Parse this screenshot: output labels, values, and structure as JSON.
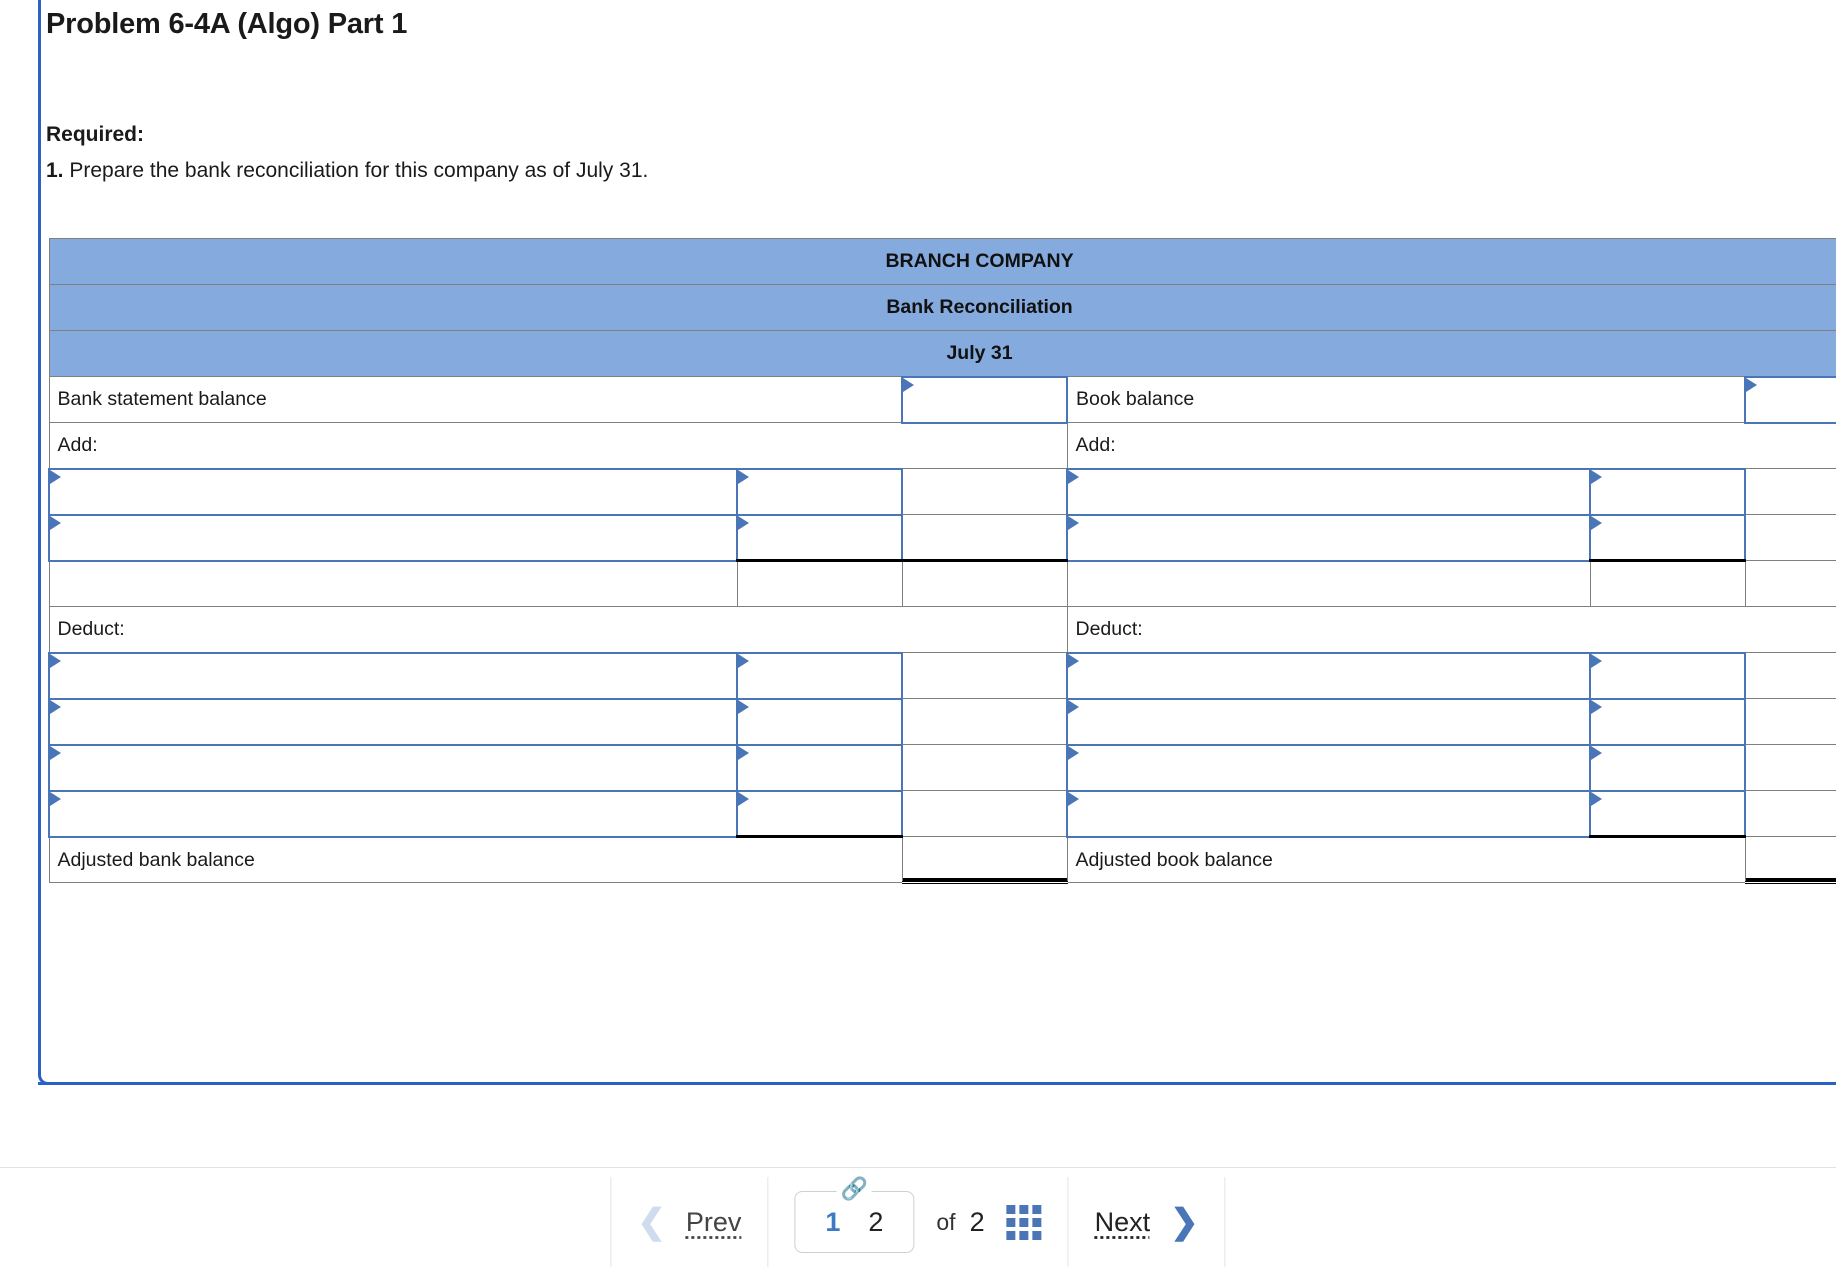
{
  "question": {
    "title": "Problem 6-4A (Algo) Part 1",
    "required_label": "Required:",
    "requirement_number": "1.",
    "requirement_text": "Prepare the bank reconciliation for this company as of July 31."
  },
  "worksheet": {
    "header": {
      "company": "BRANCH COMPANY",
      "statement": "Bank Reconciliation",
      "date": "July 31"
    },
    "left": {
      "opening_label": "Bank statement balance",
      "add_label": "Add:",
      "deduct_label": "Deduct:",
      "closing_label": "Adjusted bank balance",
      "opening_amount": "",
      "closing_amount": "",
      "add_rows": [
        {
          "description": "",
          "amount": ""
        },
        {
          "description": "",
          "amount": ""
        }
      ],
      "add_subtotal": "",
      "deduct_rows": [
        {
          "description": "",
          "amount": ""
        },
        {
          "description": "",
          "amount": ""
        },
        {
          "description": "",
          "amount": ""
        },
        {
          "description": "",
          "amount": ""
        }
      ]
    },
    "right": {
      "opening_label": "Book balance",
      "add_label": "Add:",
      "deduct_label": "Deduct:",
      "closing_label": "Adjusted book balance",
      "opening_amount": "",
      "closing_amount": "",
      "add_rows": [
        {
          "description": "",
          "amount": ""
        },
        {
          "description": "",
          "amount": ""
        }
      ],
      "add_subtotal": "",
      "deduct_rows": [
        {
          "description": "",
          "amount": ""
        },
        {
          "description": "",
          "amount": ""
        },
        {
          "description": "",
          "amount": ""
        },
        {
          "description": "",
          "amount": ""
        }
      ]
    }
  },
  "pagination": {
    "prev_label": "Prev",
    "next_label": "Next",
    "pages": [
      "1",
      "2"
    ],
    "active_page": "1",
    "of_label": "of",
    "total_pages": "2",
    "link_icon": "link-icon",
    "grid_icon": "grid-icon"
  },
  "colors": {
    "header_blue": "#85aade",
    "input_border": "#4a76b8",
    "panel_blue": "#2962c4",
    "accent": "#3d7ac4"
  }
}
